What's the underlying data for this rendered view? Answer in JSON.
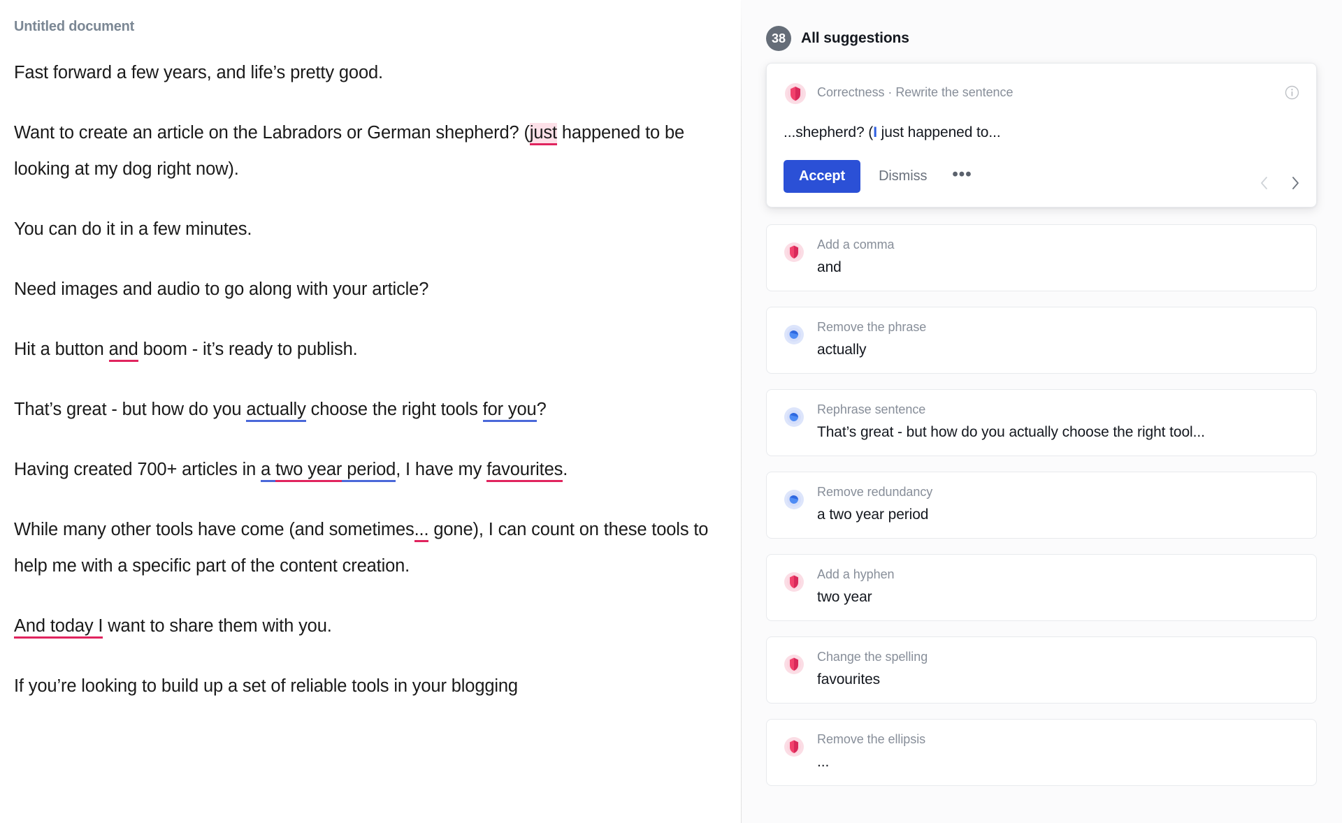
{
  "document": {
    "title": "Untitled document",
    "paragraphs": [
      {
        "id": "p1",
        "runs": [
          {
            "text": "Fast forward a few years, and life’s pretty good.",
            "mark": "none"
          }
        ]
      },
      {
        "id": "p2",
        "runs": [
          {
            "text": "Want to create an article on the Labradors or German shepherd? (",
            "mark": "none"
          },
          {
            "text": "just",
            "mark": "red-highlight"
          },
          {
            "text": " happened to be looking at my dog right now).",
            "mark": "none"
          }
        ]
      },
      {
        "id": "p3",
        "runs": [
          {
            "text": "You can do it in a few minutes.",
            "mark": "none"
          }
        ]
      },
      {
        "id": "p4",
        "runs": [
          {
            "text": "Need images and audio to go along with your article?",
            "mark": "none"
          }
        ]
      },
      {
        "id": "p5",
        "runs": [
          {
            "text": "Hit a button ",
            "mark": "none"
          },
          {
            "text": "and",
            "mark": "red"
          },
          {
            "text": " boom - it’s ready to publish.",
            "mark": "none"
          }
        ]
      },
      {
        "id": "p6",
        "runs": [
          {
            "text": "That’s great - but how do you ",
            "mark": "none"
          },
          {
            "text": "actually",
            "mark": "blue"
          },
          {
            "text": " choose the right tools ",
            "mark": "none"
          },
          {
            "text": "for you",
            "mark": "blue"
          },
          {
            "text": "?",
            "mark": "none"
          }
        ]
      },
      {
        "id": "p7",
        "runs": [
          {
            "text": "Having created 700+ articles in ",
            "mark": "none"
          },
          {
            "text": "a ",
            "mark": "blue"
          },
          {
            "text": "two year",
            "mark": "red"
          },
          {
            "text": " period",
            "mark": "blue"
          },
          {
            "text": ", I have my ",
            "mark": "none"
          },
          {
            "text": "favourites",
            "mark": "red"
          },
          {
            "text": ".",
            "mark": "none"
          }
        ]
      },
      {
        "id": "p8",
        "runs": [
          {
            "text": "While many other tools have come (and sometimes",
            "mark": "none"
          },
          {
            "text": "...",
            "mark": "red"
          },
          {
            "text": " gone), I can count on these tools to help me with a specific part of the content creation.",
            "mark": "none"
          }
        ]
      },
      {
        "id": "p9",
        "runs": [
          {
            "text": "And today I",
            "mark": "red"
          },
          {
            "text": " want to share them with you.",
            "mark": "none"
          }
        ]
      },
      {
        "id": "p10",
        "runs": [
          {
            "text": "If you’re looking to build up a set of reliable tools in your blogging",
            "mark": "none"
          }
        ]
      }
    ]
  },
  "suggestions_panel": {
    "count_badge": "38",
    "header_title": "All suggestions",
    "active_card": {
      "category": "Correctness · Rewrite the sentence",
      "icon": "correctness-shield-icon",
      "info_icon": "info-icon",
      "preview_prefix": "...shepherd? (",
      "preview_highlight": "I",
      "preview_suffix": " just happened to...",
      "accept_label": "Accept",
      "dismiss_label": "Dismiss",
      "more_label": "•••",
      "prev_icon": "chevron-left-icon",
      "next_icon": "chevron-right-icon"
    },
    "cards": [
      {
        "title": "Add a comma",
        "value": "and",
        "icon": "correctness-shield-icon",
        "kind": "correctness"
      },
      {
        "title": "Remove the phrase",
        "value": "actually",
        "icon": "clarity-drop-icon",
        "kind": "clarity"
      },
      {
        "title": "Rephrase sentence",
        "value": "That’s great - but how do you actually choose the right tool...",
        "icon": "clarity-drop-icon",
        "kind": "clarity"
      },
      {
        "title": "Remove redundancy",
        "value": "a two year period",
        "icon": "clarity-drop-icon",
        "kind": "clarity"
      },
      {
        "title": "Add a hyphen",
        "value": "two year",
        "icon": "correctness-shield-icon",
        "kind": "correctness"
      },
      {
        "title": "Change the spelling",
        "value": "favourites",
        "icon": "correctness-shield-icon",
        "kind": "correctness"
      },
      {
        "title": "Remove the ellipsis",
        "value": "...",
        "icon": "correctness-shield-icon",
        "kind": "correctness"
      }
    ]
  },
  "colors": {
    "correctness_red": "#e0245e",
    "clarity_blue": "#4a68d9",
    "accept_blue": "#2b50d6",
    "badge_gray": "#656d78",
    "highlight_pink": "#fde0e8"
  }
}
